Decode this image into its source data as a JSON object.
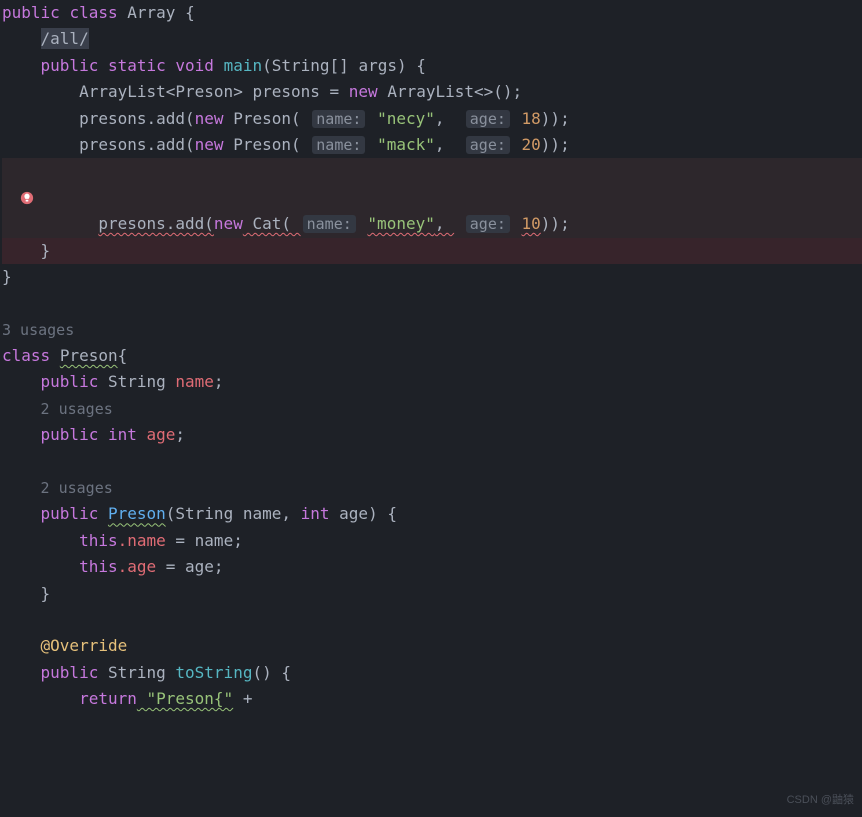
{
  "code": {
    "kw_public": "public",
    "kw_class": "class",
    "kw_static": "static",
    "kw_void": "void",
    "kw_new": "new",
    "kw_int": "int",
    "kw_this": "this",
    "kw_return": "return",
    "class_name": "Array",
    "class_preson": "Preson",
    "method_main": "main",
    "main_params": "(String[] args) {",
    "comment_all": "/all/",
    "arraylist_decl": "ArrayList<Preson> presons = ",
    "arraylist_init": " ArrayList<>();",
    "presons_add_open": "presons.add(",
    "preson_open": " Preson( ",
    "cat_open": " Cat( ",
    "hint_name": "name:",
    "hint_age": "age:",
    "str_necy": "\"necy\"",
    "str_mack": "\"mack\"",
    "str_money": "\"money\"",
    "num_18": "18",
    "num_20": "20",
    "num_10": "10",
    "close_add": "));",
    "brace_open": "{",
    "brace_close": "}",
    "semi": ";",
    "comma": ",",
    "comma_sp": ", ",
    "sp": " ",
    "field_string_name_pre": " String ",
    "field_name": "name",
    "field_int_age_pre": " ",
    "field_age": "age",
    "ctor_params": "(String name, ",
    "ctor_params2": " age) {",
    "this_name_assign": ".name",
    "assign_name": " = name;",
    "this_age_assign": ".age",
    "assign_age": " = age;",
    "override": "@Override",
    "tostring_decl": " String ",
    "tostring_name": "toString",
    "tostring_params": "() {",
    "return_preson_open": " \"Preson{\"",
    "plus": " +",
    "usages_3": "3 usages",
    "usages_2": "2 usages",
    "indent1": "    ",
    "indent2": "        ",
    "parenopen": "("
  },
  "watermark": "CSDN @鼬猿"
}
